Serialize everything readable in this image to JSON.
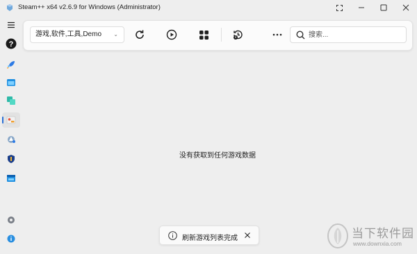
{
  "window": {
    "title": "Steam++ x64 v2.6.9 for Windows (Administrator)",
    "controls": [
      "fullscreen-icon",
      "minimize-icon",
      "maximize-icon",
      "close-icon"
    ]
  },
  "sidebar": {
    "items": [
      {
        "name": "menu",
        "icon": "hamburger-icon"
      },
      {
        "name": "help",
        "icon": "question-icon"
      },
      {
        "name": "accelerator",
        "icon": "rocket-icon"
      },
      {
        "name": "script",
        "icon": "browser-window-icon"
      },
      {
        "name": "accounts",
        "icon": "accounts-icon"
      },
      {
        "name": "game-library",
        "icon": "game-library-icon",
        "active": true
      },
      {
        "name": "arch-proxy",
        "icon": "arch-icon"
      },
      {
        "name": "authenticator",
        "icon": "shield-icon"
      },
      {
        "name": "game-list",
        "icon": "folder-icon"
      },
      {
        "name": "settings",
        "icon": "gear-icon"
      },
      {
        "name": "about",
        "icon": "info-icon"
      }
    ]
  },
  "toolbar": {
    "filter_value": "游戏,软件,工具,Demo",
    "buttons": [
      "refresh-icon",
      "play-icon",
      "grid-icon",
      "history-icon",
      "more-icon"
    ],
    "search_placeholder": "搜索..."
  },
  "main": {
    "empty_message": "没有获取到任何游戏数据"
  },
  "toast": {
    "message": "刷新游戏列表完成"
  },
  "watermark": {
    "title": "当下软件园",
    "url": "www.downxia.com"
  },
  "colors": {
    "background": "#eeeeee",
    "toolbar_bg": "#fbfbfb",
    "accent": "#2a6fd6"
  }
}
